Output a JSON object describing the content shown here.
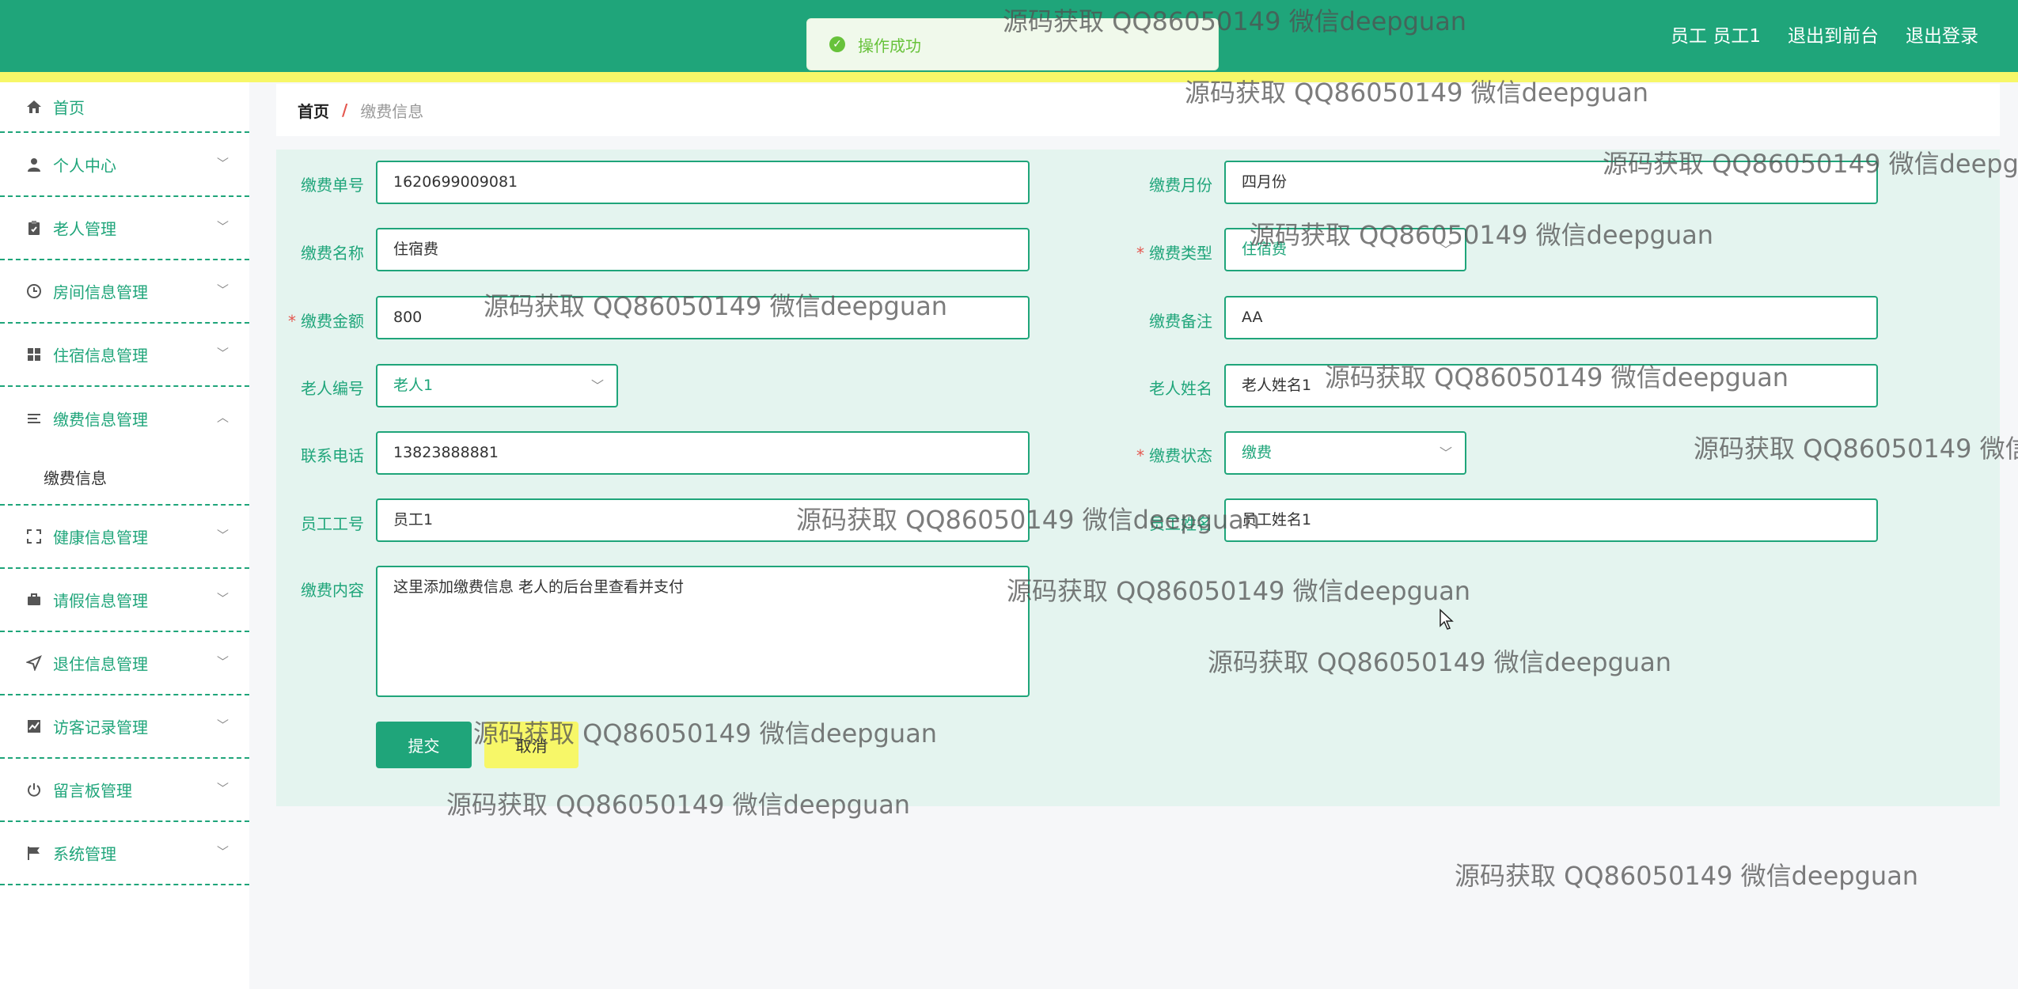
{
  "header": {
    "user_label": "员工 员工1",
    "to_frontend": "退出到前台",
    "logout": "退出登录"
  },
  "toast": {
    "message": "操作成功"
  },
  "sidebar": {
    "items": [
      {
        "label": "首页",
        "icon": "home-icon"
      },
      {
        "label": "个人中心",
        "icon": "user-icon"
      },
      {
        "label": "老人管理",
        "icon": "clipboard-icon"
      },
      {
        "label": "房间信息管理",
        "icon": "clock-icon"
      },
      {
        "label": "住宿信息管理",
        "icon": "grid-icon"
      },
      {
        "label": "缴费信息管理",
        "icon": "list-icon"
      },
      {
        "label": "健康信息管理",
        "icon": "fullscreen-icon"
      },
      {
        "label": "请假信息管理",
        "icon": "briefcase-icon"
      },
      {
        "label": "退住信息管理",
        "icon": "send-icon"
      },
      {
        "label": "访客记录管理",
        "icon": "chart-icon"
      },
      {
        "label": "留言板管理",
        "icon": "power-icon"
      },
      {
        "label": "系统管理",
        "icon": "flag-icon"
      }
    ],
    "submenu": {
      "label": "缴费信息"
    }
  },
  "breadcrumb": {
    "home": "首页",
    "separator": "/",
    "current": "缴费信息"
  },
  "form": {
    "bill_no": {
      "label": "缴费单号",
      "value": "1620699009081"
    },
    "month": {
      "label": "缴费月份",
      "value": "四月份"
    },
    "name": {
      "label": "缴费名称",
      "value": "住宿费"
    },
    "type": {
      "label": "缴费类型",
      "value": "住宿费",
      "required": "*"
    },
    "amount": {
      "label": "缴费金额",
      "value": "800",
      "required": "*"
    },
    "remark": {
      "label": "缴费备注",
      "value": "AA"
    },
    "elder_no": {
      "label": "老人编号",
      "value": "老人1"
    },
    "elder_name": {
      "label": "老人姓名",
      "value": "老人姓名1"
    },
    "phone": {
      "label": "联系电话",
      "value": "13823888881"
    },
    "status": {
      "label": "缴费状态",
      "value": "缴费",
      "required": "*"
    },
    "staff_no": {
      "label": "员工工号",
      "value": "员工1"
    },
    "staff_name": {
      "label": "员工姓名",
      "value": "员工姓名1"
    },
    "content": {
      "label": "缴费内容",
      "value": "这里添加缴费信息 老人的后台里查看并支付"
    },
    "submit": "提交",
    "cancel": "取消"
  },
  "watermark": "源码获取 QQ86050149 微信deepguan",
  "colors": {
    "primary": "#1fa57a",
    "accent_yellow": "#f7f768",
    "panel_bg": "#e4f4ef",
    "required_red": "#e4574f"
  }
}
